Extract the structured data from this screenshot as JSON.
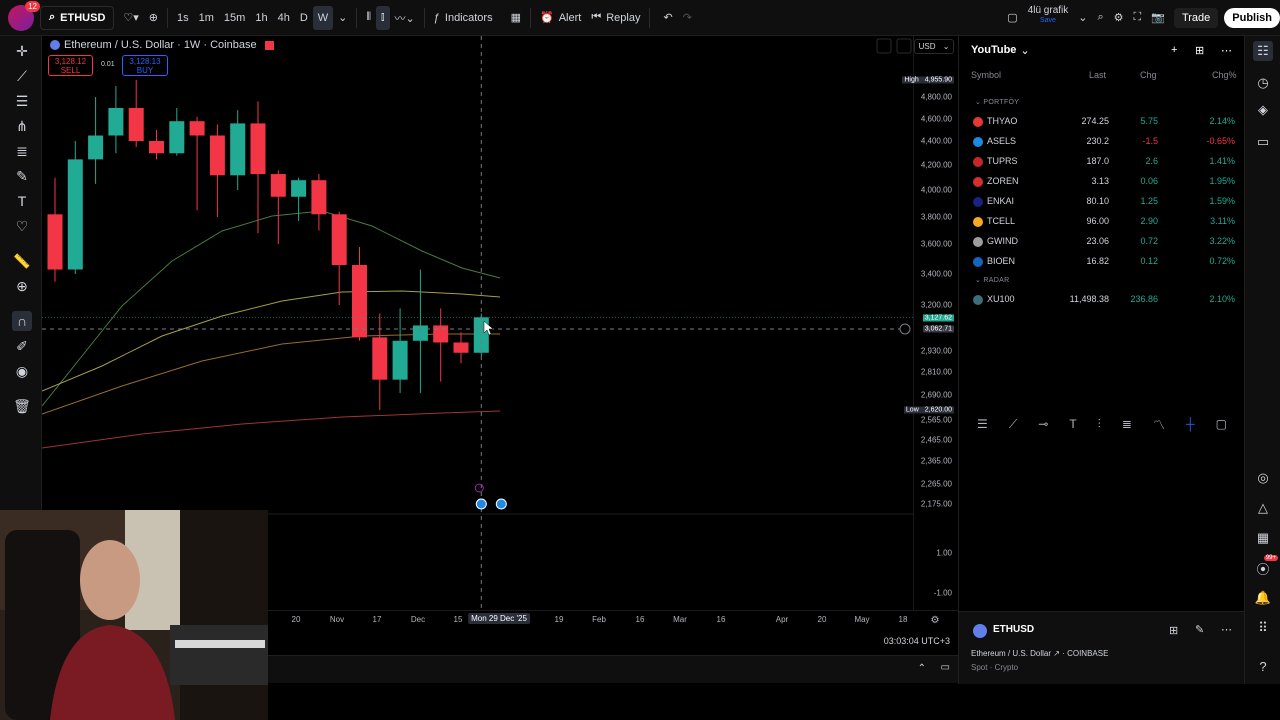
{
  "topbar": {
    "notif_count": "12",
    "symbol": "ETHUSD",
    "intervals": [
      "1s",
      "1m",
      "15m",
      "1h",
      "4h",
      "D",
      "W"
    ],
    "active_interval": "W",
    "indicators_label": "Indicators",
    "alert_label": "Alert",
    "replay_label": "Replay",
    "layout_name": "4lü grafik",
    "layout_status": "Save",
    "trade_label": "Trade",
    "publish_label": "Publish"
  },
  "chart": {
    "legend_title": "Ethereum / U.S. Dollar · 1W · Coinbase",
    "sell_price": "3,128.12",
    "sell_label": "SELL",
    "spread": "0.01",
    "buy_price": "3,128.13",
    "buy_label": "BUY",
    "currency": "USD",
    "high_label": "High",
    "high_value": "4,955.90",
    "low_label": "Low",
    "low_value": "2,620.00",
    "current_price": "3,127.62",
    "crosshair_price": "3,062.71",
    "price_ticks": [
      "4,800.00",
      "4,600.00",
      "4,400.00",
      "4,200.00",
      "4,000.00",
      "3,800.00",
      "3,600.00",
      "3,400.00",
      "3,200.00",
      "2,930.00",
      "2,810.00",
      "2,690.00",
      "2,565.00",
      "2,465.00",
      "2,365.00",
      "2,265.00",
      "2,175.00"
    ],
    "sub_ticks": [
      "1.00",
      "-1.00"
    ],
    "time_ticks": [
      "20",
      "Nov",
      "17",
      "Dec",
      "15",
      "19",
      "Feb",
      "16",
      "Mar",
      "16",
      "Apr",
      "20",
      "May",
      "18"
    ],
    "crosshair_time": "Mon 29 Dec '25",
    "clock": "03:03:04 UTC+3",
    "colors": {
      "up": "#22ab94",
      "down": "#f23645",
      "ma1": "#4c8c43",
      "ma2": "#b8b14a",
      "ma3": "#a8792e",
      "ma4": "#b23a3a"
    }
  },
  "chart_data": {
    "type": "candlestick",
    "interval": "1W",
    "symbol": "ETHUSD",
    "ohlc": [
      {
        "o": 3820,
        "h": 4100,
        "c": 3430,
        "l": 3350
      },
      {
        "o": 3430,
        "h": 4400,
        "c": 4250,
        "l": 3400
      },
      {
        "o": 4250,
        "h": 4800,
        "c": 4450,
        "l": 4050
      },
      {
        "o": 4450,
        "h": 4900,
        "c": 4700,
        "l": 4300
      },
      {
        "o": 4700,
        "h": 4955.9,
        "c": 4400,
        "l": 4350
      },
      {
        "o": 4400,
        "h": 4500,
        "c": 4300,
        "l": 4250
      },
      {
        "o": 4300,
        "h": 4700,
        "c": 4580,
        "l": 4280
      },
      {
        "o": 4580,
        "h": 4620,
        "c": 4450,
        "l": 3850
      },
      {
        "o": 4450,
        "h": 4550,
        "c": 4120,
        "l": 3800
      },
      {
        "o": 4120,
        "h": 4680,
        "c": 4560,
        "l": 4000
      },
      {
        "o": 4560,
        "h": 4760,
        "c": 4130,
        "l": 3680
      },
      {
        "o": 4130,
        "h": 4160,
        "c": 3950,
        "l": 3600
      },
      {
        "o": 3950,
        "h": 4100,
        "c": 4080,
        "l": 3770
      },
      {
        "o": 4080,
        "h": 4130,
        "c": 3820,
        "l": 3700
      },
      {
        "o": 3820,
        "h": 3840,
        "c": 3460,
        "l": 3200
      },
      {
        "o": 3460,
        "h": 3580,
        "c": 3010,
        "l": 2990
      },
      {
        "o": 3010,
        "h": 3150,
        "c": 2770,
        "l": 2620
      },
      {
        "o": 2770,
        "h": 3180,
        "c": 2990,
        "l": 2700
      },
      {
        "o": 2990,
        "h": 3430,
        "c": 3080,
        "l": 2700
      },
      {
        "o": 3080,
        "h": 3180,
        "c": 2980,
        "l": 2760
      },
      {
        "o": 2980,
        "h": 3040,
        "c": 2920,
        "l": 2860
      },
      {
        "o": 2920,
        "h": 3150,
        "c": 3127.62,
        "l": 2900
      }
    ],
    "high": 4955.9,
    "low": 2620.0,
    "last": 3127.62
  },
  "watchlist": {
    "title": "YouTube",
    "columns": {
      "symbol": "Symbol",
      "last": "Last",
      "chg": "Chg",
      "chgp": "Chg%"
    },
    "sections": [
      {
        "name": "PORTFÖY",
        "rows": [
          {
            "sym": "THYAO",
            "last": "274.25",
            "chg": "5.75",
            "chgp": "2.14%",
            "dir": "pos",
            "color": "#e53935"
          },
          {
            "sym": "ASELS",
            "last": "230.2",
            "chg": "-1.5",
            "chgp": "-0.65%",
            "dir": "neg",
            "color": "#1e88e5"
          },
          {
            "sym": "TUPRS",
            "last": "187.0",
            "chg": "2.6",
            "chgp": "1.41%",
            "dir": "pos",
            "color": "#c62828"
          },
          {
            "sym": "ZOREN",
            "last": "3.13",
            "chg": "0.06",
            "chgp": "1.95%",
            "dir": "pos",
            "color": "#d32f2f"
          },
          {
            "sym": "ENKAI",
            "last": "80.10",
            "chg": "1.25",
            "chgp": "1.59%",
            "dir": "pos",
            "color": "#1a237e"
          },
          {
            "sym": "TCELL",
            "last": "96.00",
            "chg": "2.90",
            "chgp": "3.11%",
            "dir": "pos",
            "color": "#f9a825"
          },
          {
            "sym": "GWIND",
            "last": "23.06",
            "chg": "0.72",
            "chgp": "3.22%",
            "dir": "pos",
            "color": "#9e9e9e"
          },
          {
            "sym": "BIOEN",
            "last": "16.82",
            "chg": "0.12",
            "chgp": "0.72%",
            "dir": "pos",
            "color": "#1565c0"
          }
        ]
      },
      {
        "name": "RADAR",
        "rows": [
          {
            "sym": "XU100",
            "last": "11,498.38",
            "chg": "236.86",
            "chgp": "2.10%",
            "dir": "pos",
            "color": "#3f6e7a"
          }
        ]
      }
    ]
  },
  "detail": {
    "symbol": "ETHUSD",
    "name": "Ethereum / U.S. Dollar",
    "exchange": "COINBASE",
    "type": "Spot · Crypto"
  },
  "rightbar": {
    "badge": "99+"
  }
}
